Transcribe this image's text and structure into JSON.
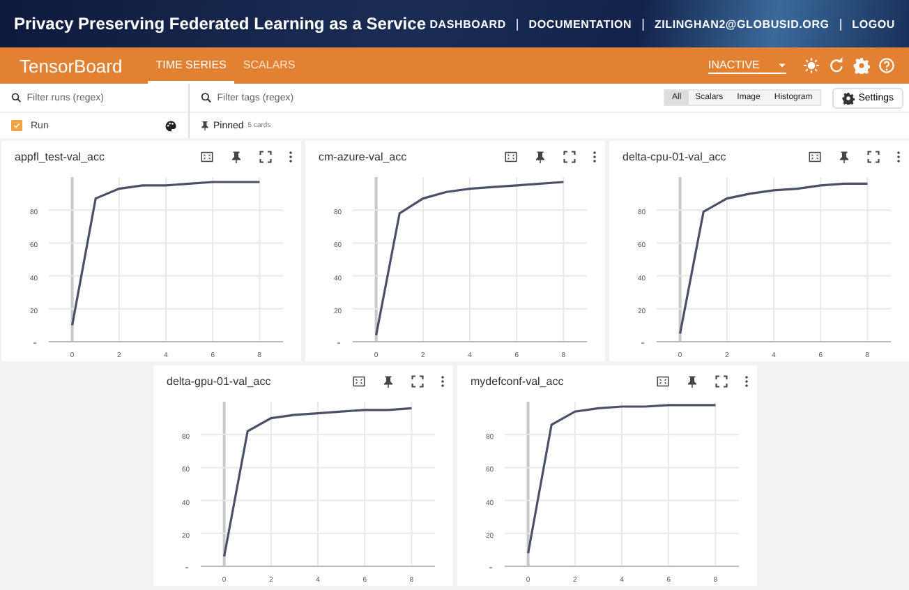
{
  "banner": {
    "title": "Privacy Preserving Federated Learning as a Service",
    "nav": [
      {
        "kind": "link",
        "label": "DASHBOARD"
      },
      {
        "kind": "separator",
        "label": "|"
      },
      {
        "kind": "link",
        "label": "DOCUMENTATION"
      },
      {
        "kind": "separator",
        "label": "|"
      },
      {
        "kind": "link",
        "label": "ZILINGHAN2@GLOBUSID.ORG"
      },
      {
        "kind": "separator",
        "label": "|"
      },
      {
        "kind": "link",
        "label": "LOGOU"
      }
    ]
  },
  "app_bar": {
    "brand": "TensorBoard",
    "tabs": [
      {
        "label": "TIME SERIES",
        "selected": true
      },
      {
        "label": "SCALARS",
        "selected": false
      }
    ],
    "status": "INACTIVE"
  },
  "filters": {
    "runs_placeholder": "Filter runs (regex)",
    "tags_placeholder": "Filter tags (regex)",
    "types": [
      {
        "label": "All",
        "selected": true
      },
      {
        "label": "Scalars",
        "selected": false
      },
      {
        "label": "Image",
        "selected": false
      },
      {
        "label": "Histogram",
        "selected": false
      }
    ],
    "settings": "Settings"
  },
  "runs": [
    {
      "label": "Run",
      "checked": true
    }
  ],
  "pinned": {
    "label": "Pinned",
    "count": "5 cards"
  },
  "cards": [
    {
      "title": "appfl_test-val_acc",
      "chart_data": {
        "type": "line",
        "x": [
          0,
          1,
          2,
          3,
          4,
          5,
          6,
          7,
          8
        ],
        "series": [
          {
            "color": "#4a5068",
            "values": [
              10,
              87,
              93,
              95,
              95,
              96,
              97,
              97,
              97
            ]
          }
        ],
        "xlim": [
          -1,
          9
        ],
        "ylim": [
          0,
          100
        ],
        "xticks": [
          0,
          2,
          4,
          6,
          8
        ],
        "yticks": [
          20,
          40,
          60,
          80
        ],
        "grid": true
      }
    },
    {
      "title": "cm-azure-val_acc",
      "chart_data": {
        "type": "line",
        "x": [
          0,
          1,
          2,
          3,
          4,
          5,
          6,
          7,
          8
        ],
        "series": [
          {
            "color": "#4a5068",
            "values": [
              4,
              78,
              87,
              91,
              93,
              94,
              95,
              96,
              97
            ]
          }
        ],
        "xlim": [
          -1,
          9
        ],
        "ylim": [
          0,
          100
        ],
        "xticks": [
          0,
          2,
          4,
          6,
          8
        ],
        "yticks": [
          20,
          40,
          60,
          80
        ],
        "grid": true
      }
    },
    {
      "title": "delta-cpu-01-val_acc",
      "chart_data": {
        "type": "line",
        "x": [
          0,
          1,
          2,
          3,
          4,
          5,
          6,
          7,
          8
        ],
        "series": [
          {
            "color": "#4a5068",
            "values": [
              5,
              79,
              87,
              90,
              92,
              93,
              95,
              96,
              96
            ]
          }
        ],
        "xlim": [
          -1,
          9
        ],
        "ylim": [
          0,
          100
        ],
        "xticks": [
          0,
          2,
          4,
          6,
          8
        ],
        "yticks": [
          20,
          40,
          60,
          80
        ],
        "grid": true
      }
    },
    {
      "title": "delta-gpu-01-val_acc",
      "chart_data": {
        "type": "line",
        "x": [
          0,
          1,
          2,
          3,
          4,
          5,
          6,
          7,
          8
        ],
        "series": [
          {
            "color": "#4a5068",
            "values": [
              6,
              82,
              90,
              92,
              93,
              94,
              95,
              95,
              96
            ]
          }
        ],
        "xlim": [
          -1,
          9
        ],
        "ylim": [
          0,
          100
        ],
        "xticks": [
          0,
          2,
          4,
          6,
          8
        ],
        "yticks": [
          20,
          40,
          60,
          80
        ],
        "grid": true
      }
    },
    {
      "title": "mydefconf-val_acc",
      "chart_data": {
        "type": "line",
        "x": [
          0,
          1,
          2,
          3,
          4,
          5,
          6,
          7,
          8
        ],
        "series": [
          {
            "color": "#4a5068",
            "values": [
              8,
              86,
              94,
              96,
              97,
              97,
              98,
              98,
              98
            ]
          }
        ],
        "xlim": [
          -1,
          9
        ],
        "ylim": [
          0,
          100
        ],
        "xticks": [
          0,
          2,
          4,
          6,
          8
        ],
        "yticks": [
          20,
          40,
          60,
          80
        ],
        "grid": true
      }
    }
  ]
}
